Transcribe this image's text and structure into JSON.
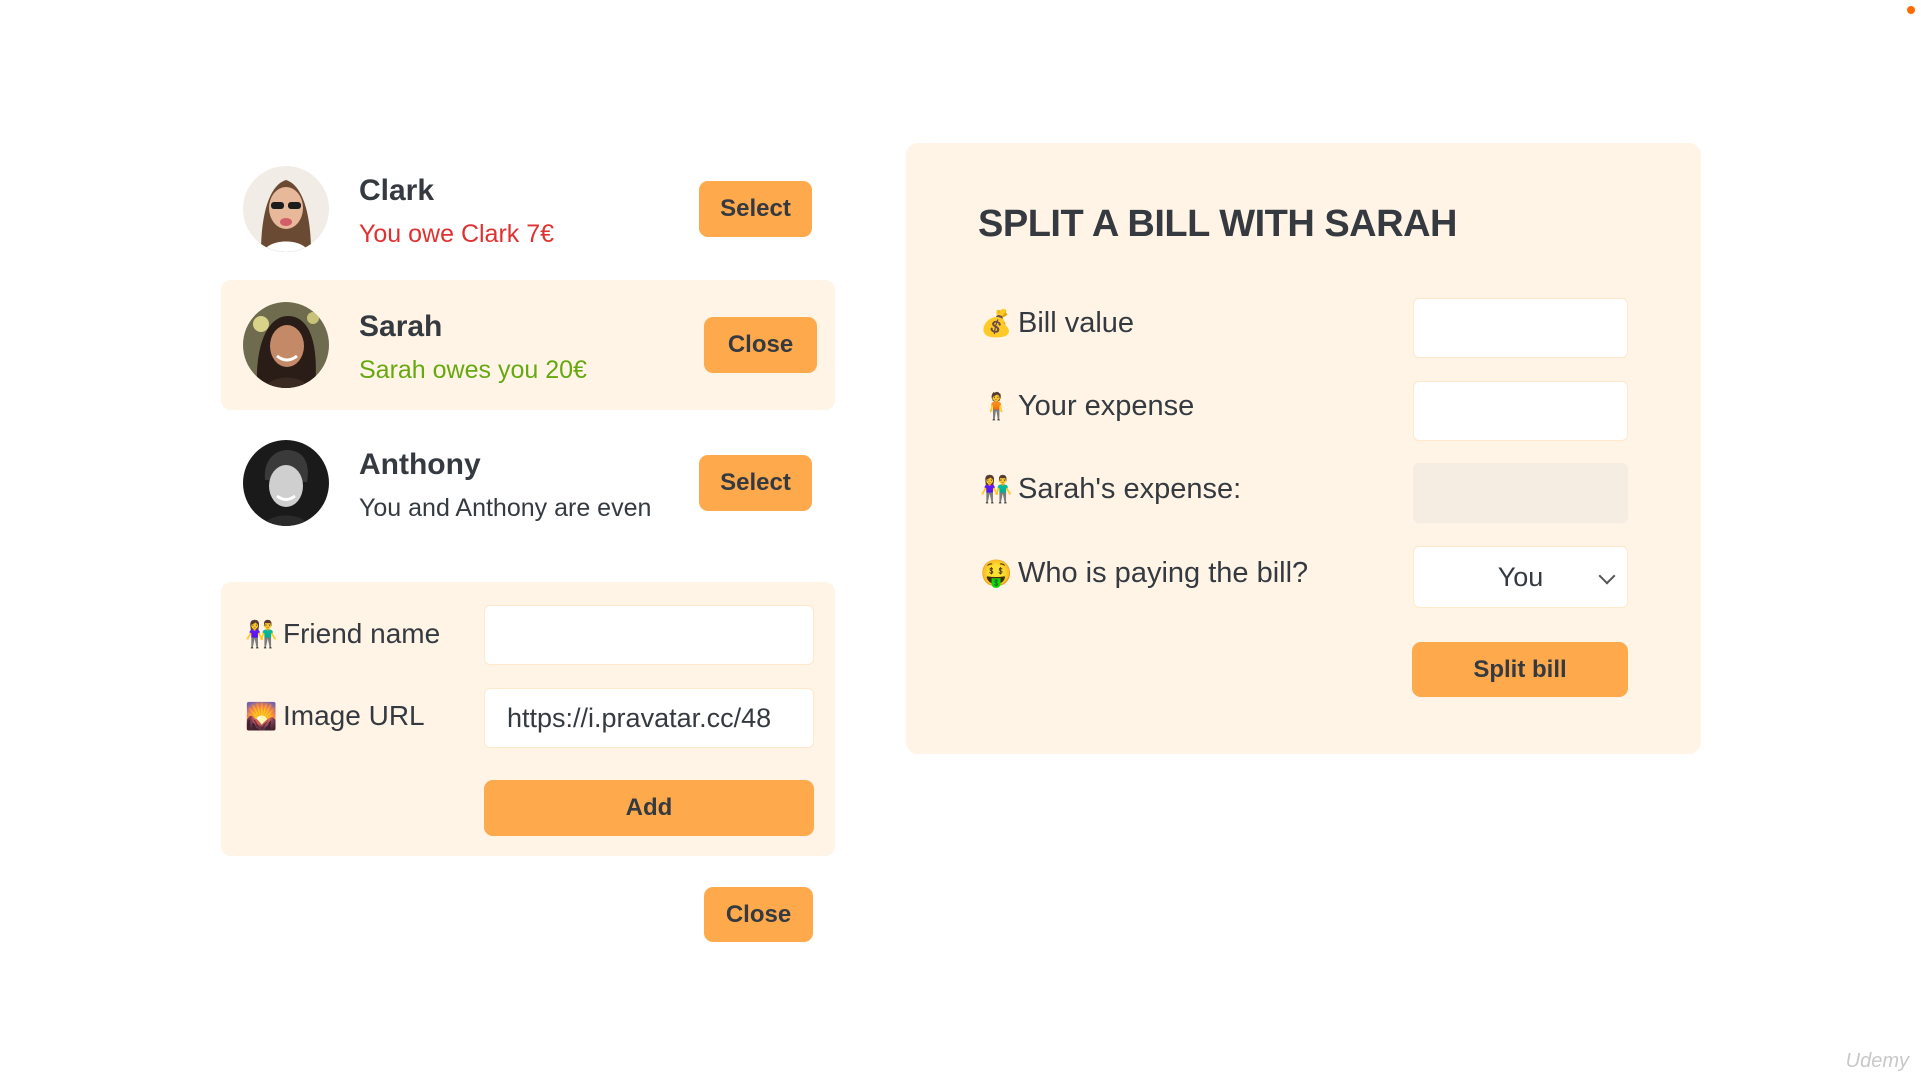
{
  "friends": [
    {
      "name": "Clark",
      "status": "You owe Clark 7€",
      "button": "Select"
    },
    {
      "name": "Sarah",
      "status": "Sarah owes you 20€",
      "button": "Close"
    },
    {
      "name": "Anthony",
      "status": "You and Anthony are even",
      "button": "Select"
    }
  ],
  "add_form": {
    "friend_name_emoji": "👫",
    "friend_name_label": "Friend name",
    "friend_name_value": "",
    "image_url_emoji": "🌄",
    "image_url_label": "Image URL",
    "image_url_value": "https://i.pravatar.cc/48",
    "add_button": "Add"
  },
  "close_button": "Close",
  "split": {
    "title": "SPLIT A BILL WITH SARAH",
    "bill_value_emoji": "💰",
    "bill_value_label": "Bill value",
    "bill_value": "",
    "your_expense_emoji": "🧍",
    "your_expense_label": "Your expense",
    "your_expense_value": "",
    "friend_expense_emoji": "👫",
    "friend_expense_label": "Sarah's expense:",
    "friend_expense_value": "",
    "payer_emoji": "🤑",
    "payer_label": "Who is paying the bill?",
    "payer_selected": "You",
    "split_button": "Split bill"
  },
  "watermark": "Udemy",
  "colors": {
    "accent": "#ffa94d",
    "panel": "#fff4e6",
    "red": "#e03131",
    "green": "#66a80f"
  }
}
